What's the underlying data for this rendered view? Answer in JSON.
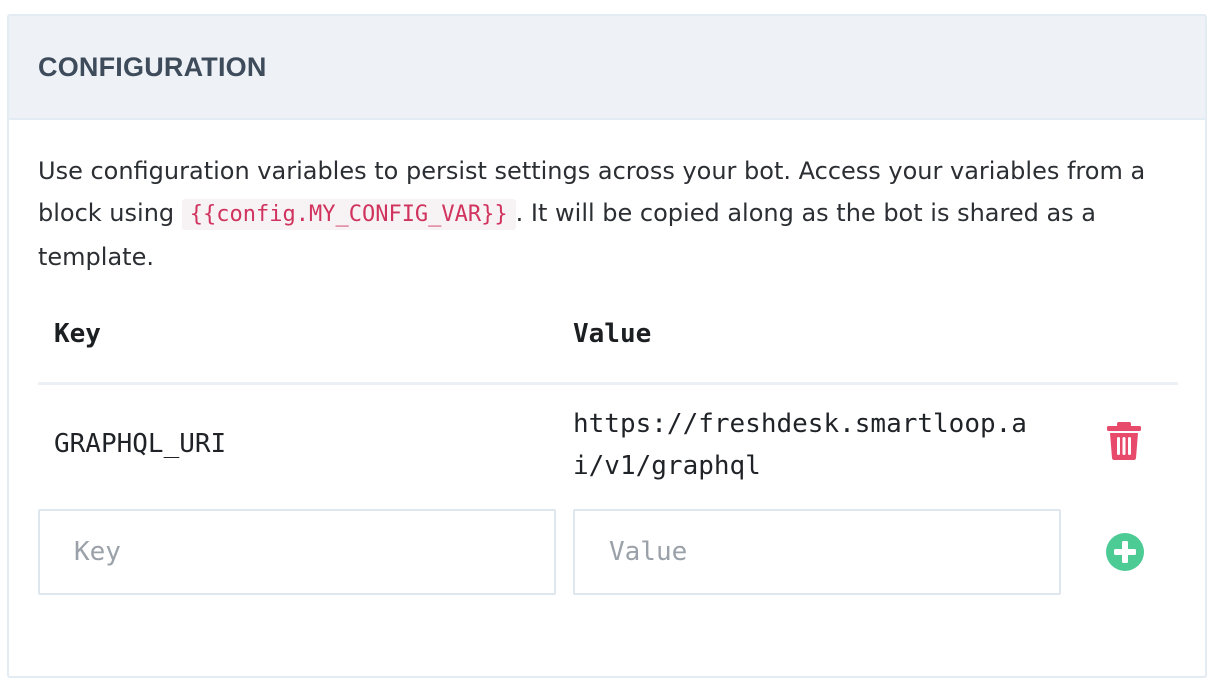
{
  "panel": {
    "title": "CONFIGURATION"
  },
  "description": {
    "before": "Use configuration variables to persist settings across your bot. Access your variables from a block using ",
    "code": "{{config.MY_CONFIG_VAR}}",
    "after": ". It will be copied along as the bot is shared as a template."
  },
  "table": {
    "headers": {
      "key": "Key",
      "value": "Value"
    },
    "rows": [
      {
        "key": "GRAPHQL_URI",
        "value": "https://freshdesk.smartloop.ai/v1/graphql"
      }
    ]
  },
  "new_entry": {
    "key_placeholder": "Key",
    "value_placeholder": "Value"
  },
  "colors": {
    "delete": "#e84a6b",
    "add": "#4ccb94",
    "code": "#d0335e"
  },
  "icons": {
    "delete": "trash-icon",
    "add": "plus-circle-icon"
  }
}
